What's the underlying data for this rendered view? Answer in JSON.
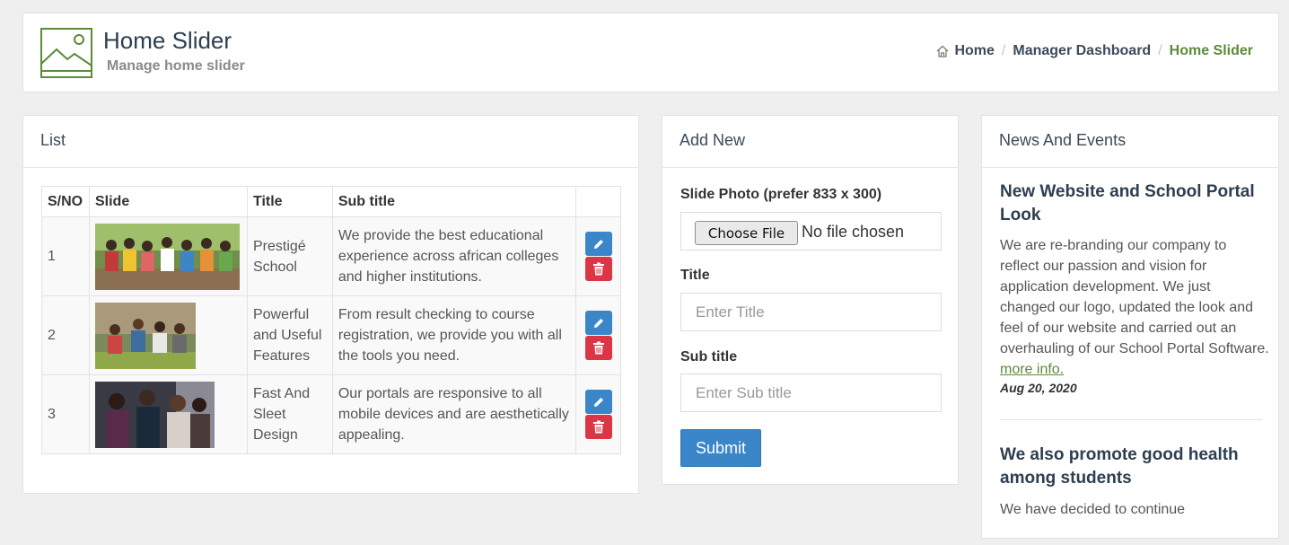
{
  "header": {
    "title": "Home Slider",
    "subtitle": "Manage home slider",
    "breadcrumb": [
      {
        "label": "Home"
      },
      {
        "label": "Manager Dashboard"
      },
      {
        "label": "Home Slider"
      }
    ],
    "icons": {
      "header": "image-icon",
      "home": "home-icon"
    }
  },
  "list": {
    "title": "List",
    "columns": [
      "S/NO",
      "Slide",
      "Title",
      "Sub title",
      ""
    ],
    "rows": [
      {
        "sno": "1",
        "slide": "group-of-students-photo",
        "title": "Prestigé School",
        "subtitle": "We provide the best educational experience across african colleges and higher institutions."
      },
      {
        "sno": "2",
        "slide": "students-outdoors-photo",
        "title": "Powerful and Useful Features",
        "subtitle": "From result checking to course registration, we provide you with all the tools you need."
      },
      {
        "sno": "3",
        "slide": "students-with-tablet-photo",
        "title": "Fast And Sleet Design",
        "subtitle": "Our portals are responsive to all mobile devices and are aesthetically appealing."
      }
    ],
    "actions": {
      "edit_icon": "pencil-icon",
      "delete_icon": "trash-icon"
    }
  },
  "add_new": {
    "title": "Add New",
    "photo_label": "Slide Photo (prefer 833 x 300)",
    "file_button": "Choose File",
    "file_status": "No file chosen",
    "title_label": "Title",
    "title_placeholder": "Enter Title",
    "subtitle_label": "Sub title",
    "subtitle_placeholder": "Enter Sub title",
    "submit": "Submit"
  },
  "news": {
    "title": "News And Events",
    "items": [
      {
        "title": "New Website and School Portal Look",
        "body": "We are re-branding our company to reflect our passion and vision for application development. We just changed our logo, updated the look and feel of our website and carried out an overhauling of our School Portal Software.",
        "more": "more info.",
        "date": "Aug 20, 2020"
      },
      {
        "title": "We also promote good health among students",
        "body": "We have decided to continue"
      }
    ]
  },
  "colors": {
    "accent_green": "#5b8a3a",
    "primary_blue": "#3b86c8",
    "danger_red": "#dc3545"
  }
}
